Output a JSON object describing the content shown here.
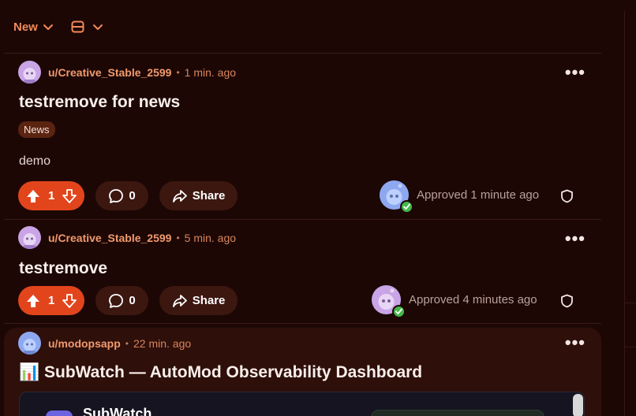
{
  "toolbar": {
    "sort_label": "New",
    "sort_icon": "chevron-down-icon",
    "view_icon": "card-view-icon"
  },
  "posts": [
    {
      "username": "u/Creative_Stable_2599",
      "time": "1 min. ago",
      "title": "testremove for news",
      "flair": "News",
      "body": "demo",
      "votes": "1",
      "comments": "0",
      "share_label": "Share",
      "approval": "Approved 1 minute ago"
    },
    {
      "username": "u/Creative_Stable_2599",
      "time": "5 min. ago",
      "title": "testremove",
      "votes": "1",
      "comments": "0",
      "share_label": "Share",
      "approval": "Approved 4 minutes ago"
    },
    {
      "username": "u/modopsapp",
      "time": "22 min. ago",
      "title": "📊 SubWatch — AutoMod Observability Dashboard",
      "preview_name": "SubWatch"
    }
  ],
  "colors": {
    "background": "#1c0705",
    "accent": "#e2451c",
    "link": "#f29a6e",
    "approved_check": "#46b84a"
  }
}
